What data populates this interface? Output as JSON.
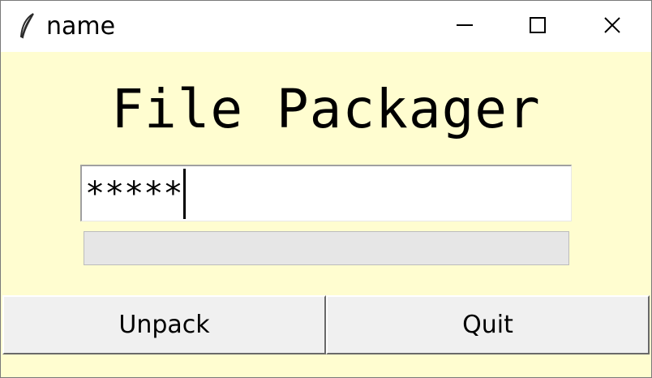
{
  "window": {
    "title": "name",
    "icon": "feather-icon",
    "controls": {
      "minimize": "minimize-icon",
      "maximize": "maximize-icon",
      "close": "close-icon"
    }
  },
  "main": {
    "heading": "File Packager",
    "password_field": {
      "value": "*****"
    },
    "progress": {
      "value": 0
    }
  },
  "buttons": {
    "unpack_label": "Unpack",
    "quit_label": "Quit"
  },
  "colors": {
    "background": "#fffdd0",
    "titlebar": "#ffffff",
    "button_face": "#f0f0f0",
    "progress_trough": "#e6e6e6"
  }
}
